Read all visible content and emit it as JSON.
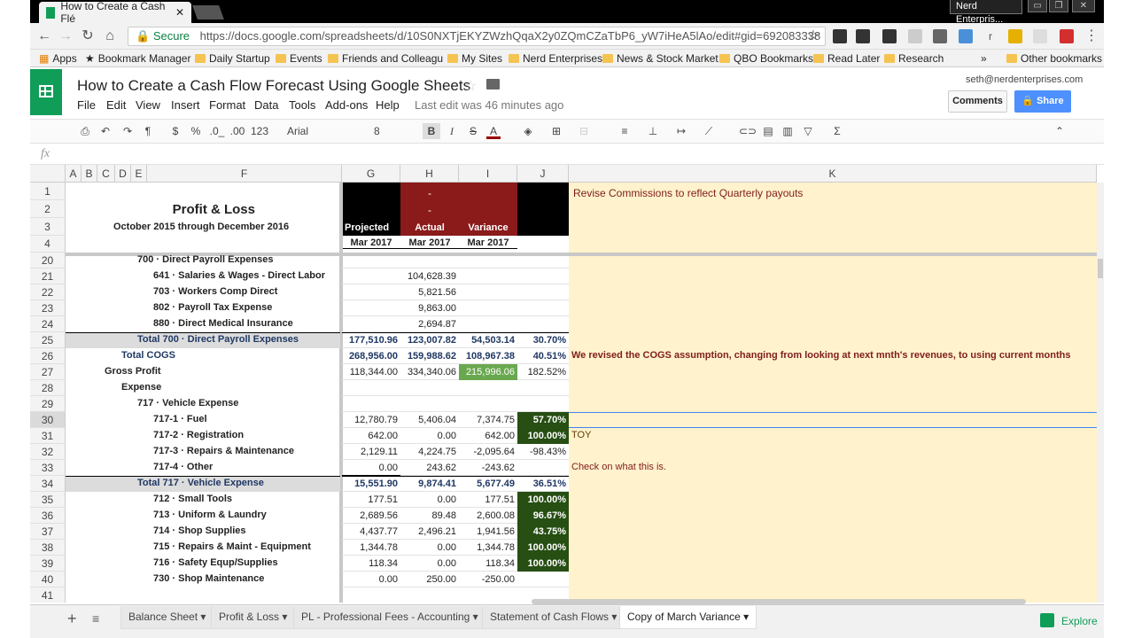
{
  "browser": {
    "tab_title": "How to Create a Cash Flé",
    "profile_name": "Nerd Enterpris...",
    "secure_label": "Secure",
    "url": "https://docs.google.com/spreadsheets/d/10S0NXTjEKYZWzhQqaX2y0ZQmCZaTbP6_yW7iHeA5lAo/edit#gid=692083338",
    "bookmarks": [
      "Apps",
      "Bookmark Manager",
      "Daily Startup",
      "Events",
      "Friends and Colleagu",
      "My Sites",
      "Nerd Enterprises",
      "News & Stock Market",
      "QBO Bookmarks",
      "Read Later",
      "Research",
      "Other bookmarks"
    ],
    "overflow": "»"
  },
  "sheets": {
    "title": "How to Create a Cash Flow Forecast Using Google Sheets",
    "menu": [
      "File",
      "Edit",
      "View",
      "Insert",
      "Format",
      "Data",
      "Tools",
      "Add-ons",
      "Help"
    ],
    "last_edit": "Last edit was 46 minutes ago",
    "user_email": "seth@nerdenterprises.com",
    "comments_label": "Comments",
    "share_label": "Share",
    "toolbar": {
      "currency": "$",
      "percent": "%",
      "dec_less": ".0_",
      "dec_more": ".00",
      "format": "123",
      "font": "Arial",
      "size": "8",
      "bold": "B",
      "italic": "I",
      "strike": "S",
      "textcolor": "A",
      "sigma": "Σ"
    },
    "fx": "fx"
  },
  "columns": [
    "A",
    "B",
    "C",
    "D",
    "E",
    "F",
    "G",
    "H",
    "I",
    "J",
    "K"
  ],
  "header_rows": {
    "r1_h": "-",
    "r1_k": "Revise Commissions to reflect Quarterly payouts",
    "r2_f": "Profit & Loss",
    "r2_h": "-",
    "r3_f": "October 2015 through December 2016",
    "r3_g": "Projected",
    "r3_h": "Actual",
    "r3_i": "Variance",
    "r4_g": "Mar 2017",
    "r4_h": "Mar 2017",
    "r4_i": "Mar 2017"
  },
  "rows": [
    {
      "n": "1"
    },
    {
      "n": "2"
    },
    {
      "n": "3"
    },
    {
      "n": "4"
    },
    {
      "n": "20",
      "label": "700 · Direct Payroll Expenses",
      "g": "",
      "h": "",
      "i": "",
      "j": "",
      "k": ""
    },
    {
      "n": "21",
      "label": "641 · Salaries & Wages - Direct Labor",
      "g": "",
      "h": "104,628.39",
      "i": "",
      "j": "",
      "k": ""
    },
    {
      "n": "22",
      "label": "703 · Workers Comp Direct",
      "g": "",
      "h": "5,821.56",
      "i": "",
      "j": "",
      "k": ""
    },
    {
      "n": "23",
      "label": "802 · Payroll Tax Expense",
      "g": "",
      "h": "9,863.00",
      "i": "",
      "j": "",
      "k": ""
    },
    {
      "n": "24",
      "label": "880 · Direct Medical Insurance",
      "g": "",
      "h": "2,694.87",
      "i": "",
      "j": "",
      "k": ""
    },
    {
      "n": "25",
      "label": "Total 700 · Direct Payroll Expenses",
      "g": "177,510.96",
      "h": "123,007.82",
      "i": "54,503.14",
      "j": "30.70%",
      "k": ""
    },
    {
      "n": "26",
      "label": "Total COGS",
      "g": "268,956.00",
      "h": "159,988.62",
      "i": "108,967.38",
      "j": "40.51%",
      "k": "We revised the COGS assumption, changing from looking at next mnth's revenues, to using current months"
    },
    {
      "n": "27",
      "label": "Gross Profit",
      "g": "118,344.00",
      "h": "334,340.06",
      "i": "215,996.06",
      "j": "182.52%",
      "k": ""
    },
    {
      "n": "28",
      "label": "Expense",
      "g": "",
      "h": "",
      "i": "",
      "j": "",
      "k": ""
    },
    {
      "n": "29",
      "label": "717 · Vehicle Expense",
      "g": "",
      "h": "",
      "i": "",
      "j": "",
      "k": ""
    },
    {
      "n": "30",
      "label": "717-1 · Fuel",
      "g": "12,780.79",
      "h": "5,406.04",
      "i": "7,374.75",
      "j": "57.70%",
      "k": ""
    },
    {
      "n": "31",
      "label": "717-2 · Registration",
      "g": "642.00",
      "h": "0.00",
      "i": "642.00",
      "j": "100.00%",
      "k": "TOY"
    },
    {
      "n": "32",
      "label": "717-3 · Repairs & Maintenance",
      "g": "2,129.11",
      "h": "4,224.75",
      "i": "-2,095.64",
      "j": "-98.43%",
      "k": ""
    },
    {
      "n": "33",
      "label": "717-4 · Other",
      "g": "0.00",
      "h": "243.62",
      "i": "-243.62",
      "j": "",
      "k": "Check on what this is."
    },
    {
      "n": "34",
      "label": "Total 717 · Vehicle Expense",
      "g": "15,551.90",
      "h": "9,874.41",
      "i": "5,677.49",
      "j": "36.51%",
      "k": ""
    },
    {
      "n": "35",
      "label": "712 · Small Tools",
      "g": "177.51",
      "h": "0.00",
      "i": "177.51",
      "j": "100.00%",
      "k": ""
    },
    {
      "n": "36",
      "label": "713 · Uniform & Laundry",
      "g": "2,689.56",
      "h": "89.48",
      "i": "2,600.08",
      "j": "96.67%",
      "k": ""
    },
    {
      "n": "37",
      "label": "714 · Shop Supplies",
      "g": "4,437.77",
      "h": "2,496.21",
      "i": "1,941.56",
      "j": "43.75%",
      "k": ""
    },
    {
      "n": "38",
      "label": "715 · Repairs & Maint - Equipment",
      "g": "1,344.78",
      "h": "0.00",
      "i": "1,344.78",
      "j": "100.00%",
      "k": ""
    },
    {
      "n": "39",
      "label": "716 · Safety Equp/Supplies",
      "g": "118.34",
      "h": "0.00",
      "i": "118.34",
      "j": "100.00%",
      "k": ""
    },
    {
      "n": "40",
      "label": "730 · Shop Maintenance",
      "g": "0.00",
      "h": "250.00",
      "i": "-250.00",
      "j": "",
      "k": ""
    },
    {
      "n": "41",
      "label": "",
      "g": "",
      "h": "",
      "i": "",
      "j": "",
      "k": ""
    }
  ],
  "sheet_tabs": [
    "Balance Sheet",
    "Profit & Loss",
    "PL - Professional Fees - Accounting",
    "Statement of Cash Flows",
    "Copy of March Variance"
  ],
  "explore_label": "Explore",
  "colors": {
    "sheets_green": "#0f9d58",
    "dark_red": "#8b1a1a",
    "dark_green": "#274e13",
    "highlight_green": "#6aa84f",
    "note_yellow": "#fff2cc",
    "total_blue": "#1f3864",
    "share_blue": "#4d90fe"
  }
}
